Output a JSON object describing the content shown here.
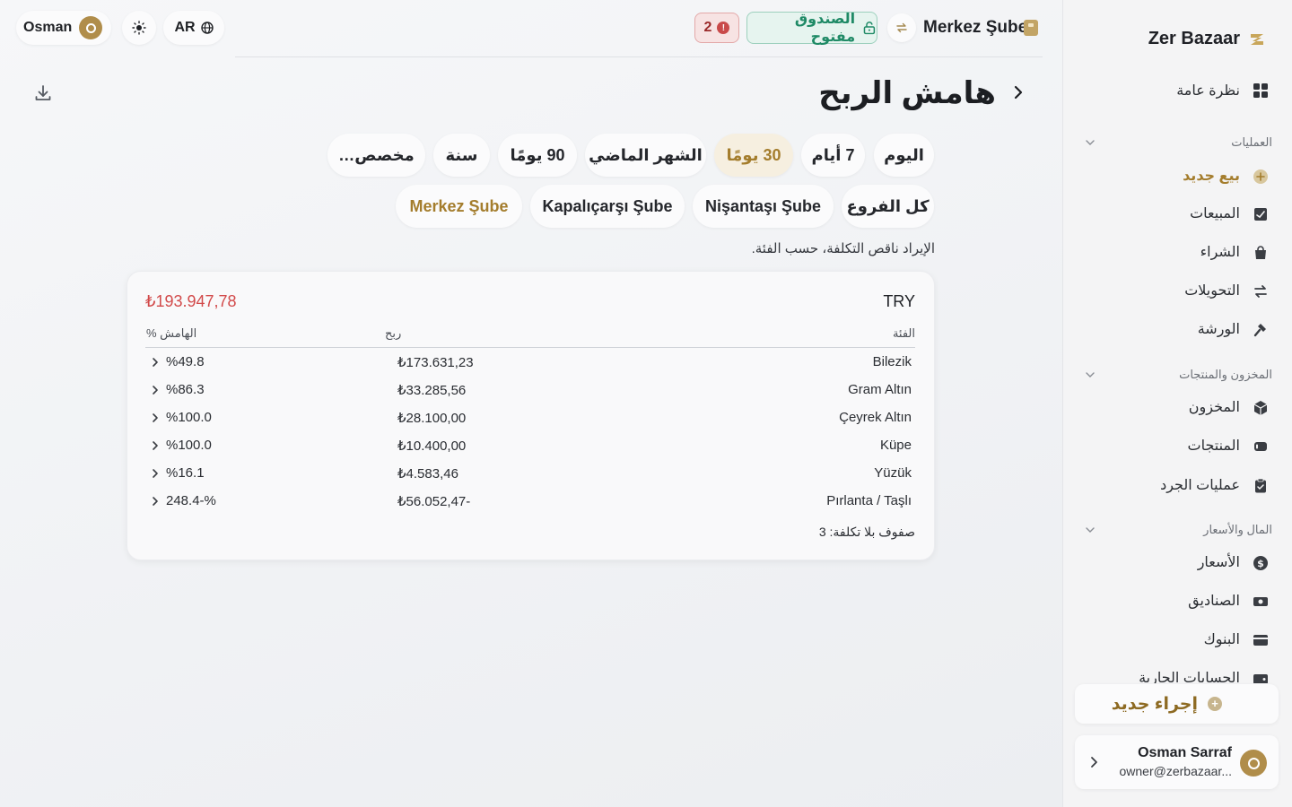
{
  "topbar": {
    "user_name": "Osman",
    "language": "AR",
    "alert_count": "2",
    "cash_status": "الصندوق مفتوح",
    "branch": "Merkez Şube"
  },
  "page": {
    "title": "هامش الربح",
    "subtitle": "الإيراد ناقص التكلفة، حسب الفئة."
  },
  "periods": [
    {
      "label": "اليوم"
    },
    {
      "label": "7 أيام"
    },
    {
      "label": "30 يومًا",
      "active": true
    },
    {
      "label": "الشهر الماضي"
    },
    {
      "label": "90 يومًا"
    },
    {
      "label": "سنة"
    },
    {
      "label": "مخصص…"
    }
  ],
  "branches": [
    {
      "label": "كل الفروع"
    },
    {
      "label": "Nişantaşı Şube"
    },
    {
      "label": "Kapalıçarşı Şube"
    },
    {
      "label": "Merkez Şube",
      "active": true
    }
  ],
  "card": {
    "currency": "TRY",
    "total": "₺193.947,78",
    "col_category": "الفئة",
    "col_profit": "ربح",
    "col_margin": "الهامش %",
    "rows": [
      {
        "category": "Bilezik",
        "profit": "₺173.631,23",
        "margin": "%49.8"
      },
      {
        "category": "Gram Altın",
        "profit": "₺33.285,56",
        "margin": "%86.3"
      },
      {
        "category": "Çeyrek Altın",
        "profit": "₺28.100,00",
        "margin": "%100.0"
      },
      {
        "category": "Küpe",
        "profit": "₺10.400,00",
        "margin": "%100.0"
      },
      {
        "category": "Yüzük",
        "profit": "₺4.583,46",
        "margin": "%16.1"
      },
      {
        "category": "Pırlanta / Taşlı",
        "profit": "₺56.052,47-",
        "margin": "248.4-%"
      }
    ],
    "footnote": "صفوف بلا تكلفة: 3"
  },
  "sidebar": {
    "brand": "Zer Bazaar",
    "overview": "نظرة عامة",
    "sections": {
      "operations": "العمليات",
      "inventory": "المخزون والمنتجات",
      "money": "المال والأسعار"
    },
    "items": {
      "new_sale": "بيع جديد",
      "sales": "المبيعات",
      "purchase": "الشراء",
      "transfers": "التحويلات",
      "workshop": "الورشة",
      "stock": "المخزون",
      "products": "المنتجات",
      "stocktake": "عمليات الجرد",
      "prices": "الأسعار",
      "cashboxes": "الصناديق",
      "banks": "البنوك",
      "current_accounts": "الحسابات الجارية"
    },
    "new_action": "إجراء جديد",
    "user": {
      "name": "Osman Sarraf",
      "email": "owner@zerbazaar..."
    }
  },
  "colors": {
    "accent": "#a47d2d",
    "negative": "#d24a4a",
    "cash_open": "#1f8a66"
  }
}
